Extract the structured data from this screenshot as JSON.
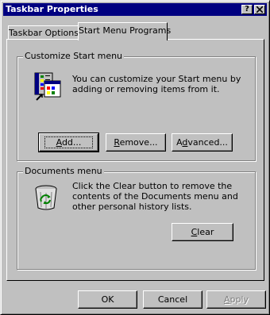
{
  "window": {
    "title": "Taskbar Properties",
    "help_button": "?",
    "close_button": "x"
  },
  "tabs": [
    {
      "label": "Taskbar Options",
      "active": false
    },
    {
      "label": "Start Menu Programs",
      "active": true
    }
  ],
  "customize_group": {
    "legend": "Customize Start menu",
    "description": "You can customize your Start menu by adding or removing items from it.",
    "icon": "start-menu-icon",
    "buttons": {
      "add": {
        "accel": "A",
        "rest": "dd..."
      },
      "remove": {
        "accel": "R",
        "rest": "emove..."
      },
      "advanced": {
        "before": "A",
        "accel": "d",
        "rest": "vanced..."
      }
    }
  },
  "documents_group": {
    "legend": "Documents menu",
    "description": "Click the Clear button to remove the contents of the Documents menu and other personal history lists.",
    "icon": "recycle-bin-icon",
    "clear": {
      "accel": "C",
      "rest": "lear"
    }
  },
  "footer": {
    "ok": "OK",
    "cancel": "Cancel",
    "apply": {
      "accel": "A",
      "rest": "pply"
    }
  },
  "colors": {
    "titlebar": "#000080",
    "face": "#c0c0c0"
  }
}
